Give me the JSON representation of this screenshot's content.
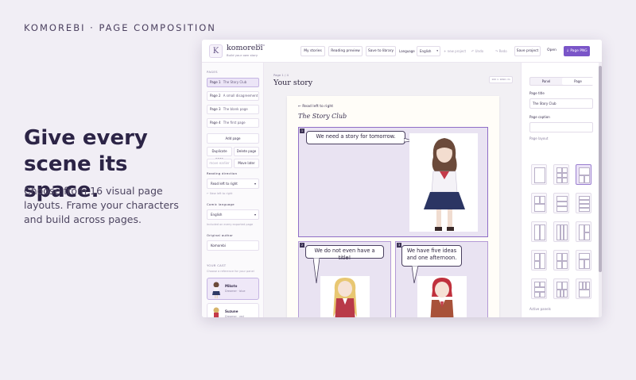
{
  "hero": {
    "brand_line": "KOMOREBI · PAGE COMPOSITION",
    "headline": "Give every scene its space.",
    "subcopy": "Choose from 16 visual page layouts. Frame your characters and build across pages."
  },
  "app": {
    "logo_letter": "K",
    "name": "komorebi",
    "beta": "Beta",
    "tagline": "Build your own story",
    "toolbar": {
      "my_stories": "My stories",
      "reading_preview": "Reading preview",
      "save_to_library": "Save to library",
      "language_label": "Language",
      "language_value": "English",
      "new_project": "+ new project",
      "undo": "↶ Undo",
      "redo": "↷ Redo",
      "save_project": "Save project",
      "open": "Open",
      "export": "↓ Page PNG"
    },
    "sidebar": {
      "pages_label": "PAGES",
      "pages": [
        {
          "num": "Page 1",
          "title": "The Story Club"
        },
        {
          "num": "Page 2",
          "title": "A small disagreement"
        },
        {
          "num": "Page 3",
          "title": "The blank page"
        },
        {
          "num": "Page 4",
          "title": "The first page"
        }
      ],
      "add_page": "Add page",
      "duplicate_page": "Duplicate page",
      "delete_page": "Delete page",
      "move_earlier": "move earlier",
      "move_later": "Move later",
      "reading_direction_label": "Reading direction",
      "reading_direction_value": "Read left to right",
      "reading_direction_note": "← New left to right",
      "comic_language_label": "Comic language",
      "comic_language_value": "English",
      "comic_language_note": "Included on every exported page",
      "original_author_label": "Original author",
      "original_author_value": "Komorebi",
      "cast_label": "YOUR CAST",
      "cast_hint": "Choose a reference for your panel",
      "cast": [
        {
          "name": "Mikoto",
          "role": "Dreamer · blue"
        },
        {
          "name": "Suzune",
          "role": "Dreamer · red"
        }
      ]
    },
    "canvas": {
      "page_count": "Page 1 / 4",
      "heading": "Your story",
      "size_badge": "100 × 1690 cm",
      "read_direction": "← Read left to right",
      "story_title": "The Story Club",
      "panels": [
        {
          "num": "1",
          "bubble": "We need a story for tomorrow."
        },
        {
          "num": "2",
          "bubble": "We do not even have a title!"
        },
        {
          "num": "3",
          "bubble": "We have five ideas and one afternoon."
        }
      ]
    },
    "inspector": {
      "tab_panel": "Panel",
      "tab_page": "Page",
      "page_title_label": "Page title",
      "page_title_value": "The Story Club",
      "page_caption_label": "Page caption",
      "page_caption_value": "",
      "page_layout_label": "Page layout",
      "active_panels_label": "Active panels"
    }
  },
  "colors": {
    "accent": "#7a55c8",
    "panel_fill": "#e9e3f2",
    "panel_border": "#b39ad6",
    "background": "#f1eef5"
  }
}
